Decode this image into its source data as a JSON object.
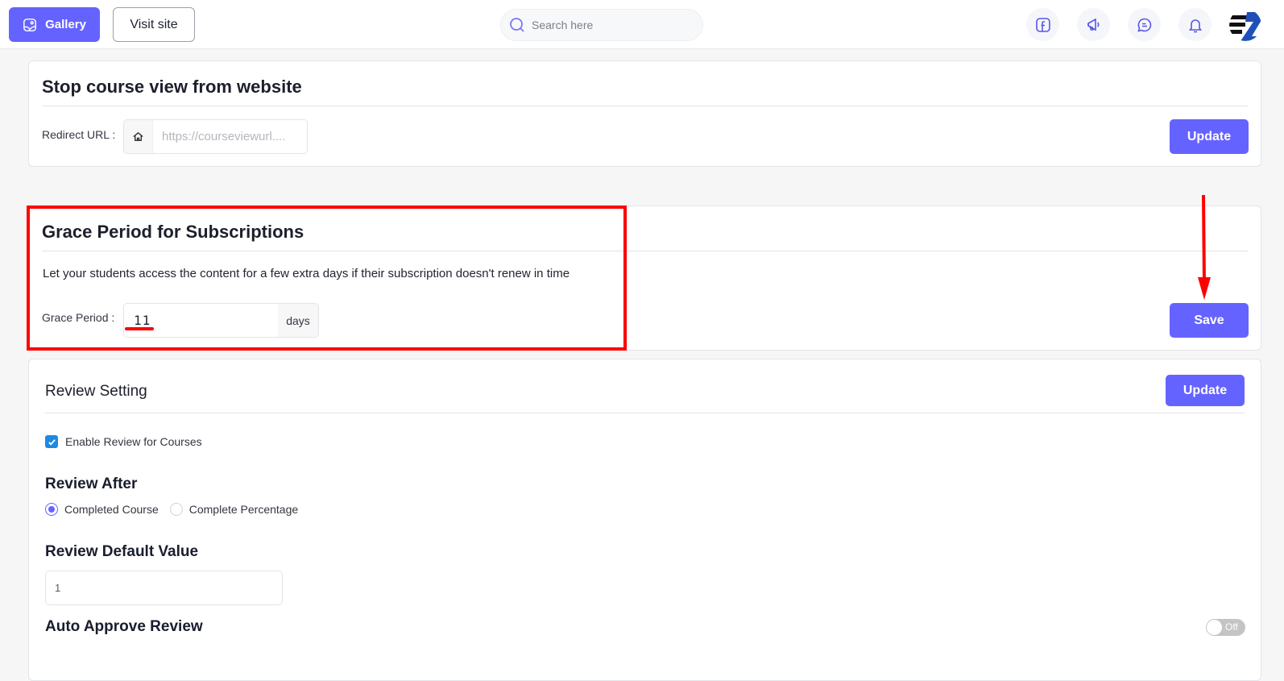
{
  "topbar": {
    "gallery_label": "Gallery",
    "visit_site_label": "Visit site",
    "search_placeholder": "Search here",
    "icons": [
      "facebook-icon",
      "megaphone-icon",
      "chat-icon",
      "bell-icon"
    ]
  },
  "stop_course": {
    "title": "Stop course view from website",
    "redirect_label": "Redirect URL :",
    "redirect_placeholder": "https://courseviewurl....",
    "redirect_value": "",
    "update_label": "Update"
  },
  "grace_period": {
    "title": "Grace Period for Subscriptions",
    "description": "Let your students access the content for a few extra days if their subscription doesn't renew in time",
    "label": "Grace Period :",
    "value": "11",
    "suffix": "days",
    "save_label": "Save"
  },
  "review": {
    "title": "Review Setting",
    "update_label": "Update",
    "enable_label": "Enable Review for Courses",
    "enable_checked": true,
    "review_after_title": "Review After",
    "review_after_options": [
      {
        "label": "Completed Course",
        "selected": true
      },
      {
        "label": "Complete Percentage",
        "selected": false
      }
    ],
    "default_value_title": "Review Default Value",
    "default_value": "1",
    "auto_approve_title": "Auto Approve Review",
    "auto_approve_state": "Off"
  },
  "colors": {
    "primary": "#6563ff",
    "annotation": "#ff0000",
    "checkbox": "#1e88e5"
  }
}
